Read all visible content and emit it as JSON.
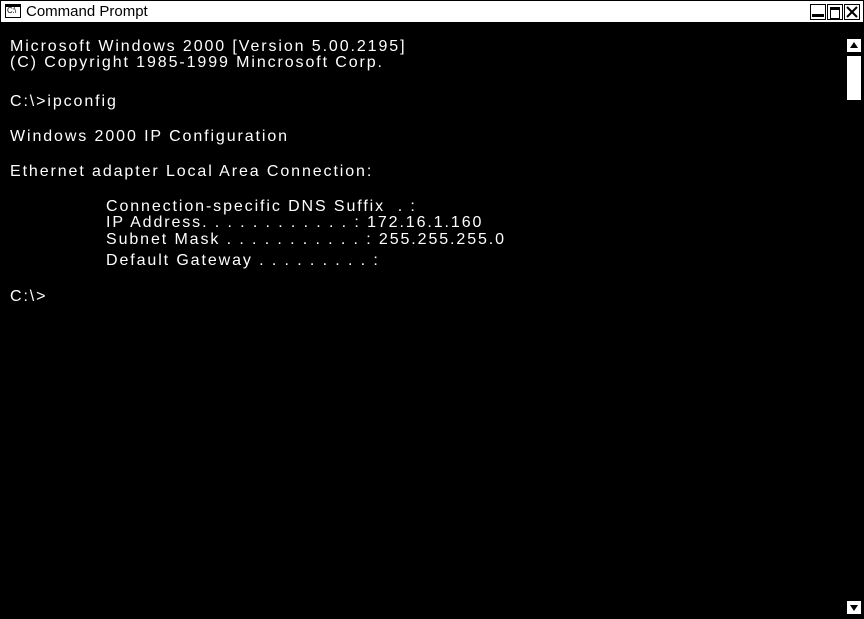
{
  "window": {
    "title": "Command Prompt",
    "icon_label": "C:\\"
  },
  "console": {
    "lines": [
      "Microsoft Windows 2000 [Version 5.00.2195]",
      "(C) Copyright 1985-1999 Mincrosoft Corp.",
      "C:\\>ipconfig",
      "Windows 2000 IP Configuration",
      "Ethernet adapter Local Area Connection:",
      "Connection-specific DNS Suffix  . :",
      "IP Address. . . . . . . . . . . . : 172.16.1.160",
      "Subnet Mask . . . . . . . . . . . : 255.255.255.0",
      "Default Gateway . . . . . . . . . :",
      "C:\\>"
    ]
  },
  "icons": {
    "window_icon": "command-prompt-icon",
    "minimize": "minimize-icon",
    "maximize": "maximize-icon",
    "close": "close-icon",
    "scroll_up": "arrow-up-icon",
    "scroll_down": "arrow-down-icon"
  },
  "colors": {
    "console_background": "#000000",
    "console_text": "#ffffff",
    "titlebar_background": "#ffffff"
  }
}
